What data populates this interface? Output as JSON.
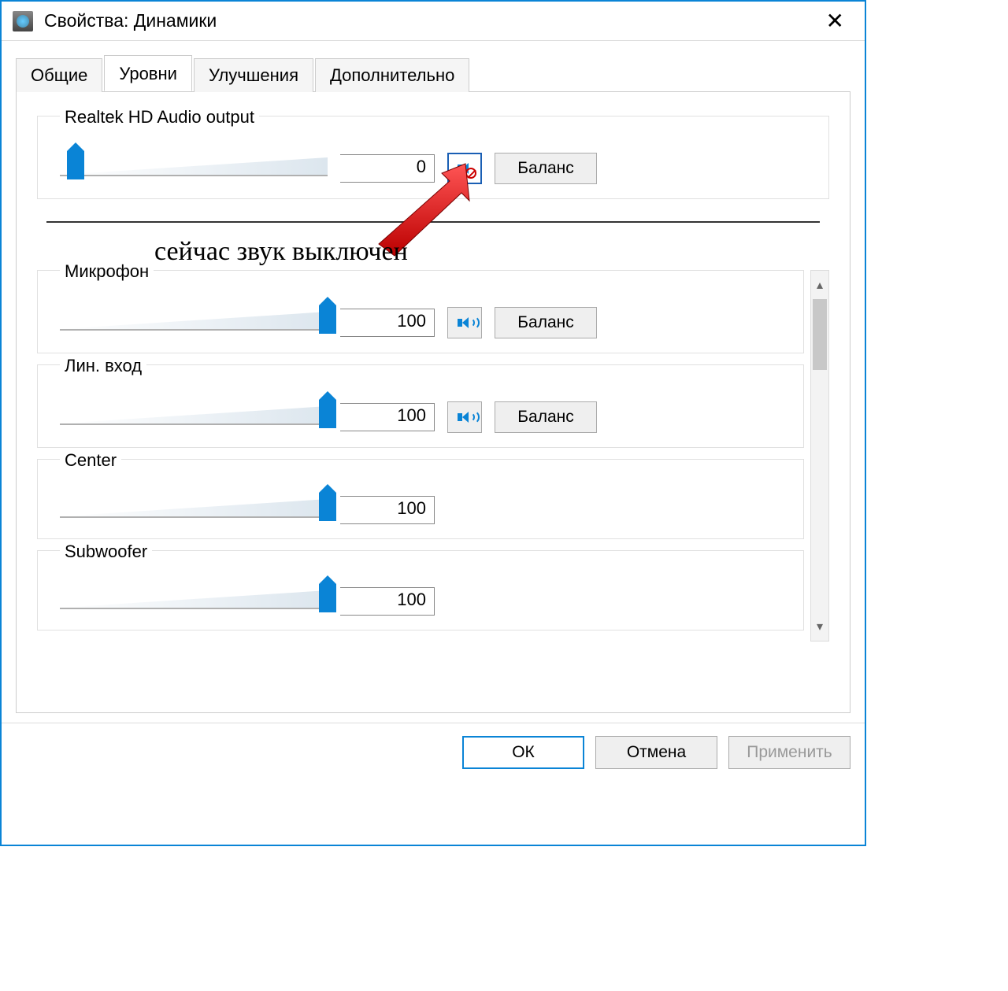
{
  "window": {
    "title": "Свойства: Динамики"
  },
  "tabs": [
    {
      "label": "Общие",
      "active": false
    },
    {
      "label": "Уровни",
      "active": true
    },
    {
      "label": "Улучшения",
      "active": false
    },
    {
      "label": "Дополнительно",
      "active": false
    }
  ],
  "main_device": {
    "name": "Realtek HD Audio output",
    "value": "0",
    "slider_percent": 6,
    "muted": true,
    "balance_label": "Баланс"
  },
  "annotation": {
    "text": "сейчас звук выключен"
  },
  "channels": [
    {
      "name": "Микрофон",
      "value": "100",
      "slider_percent": 100,
      "has_mute": true,
      "muted": false,
      "balance_label": "Баланс"
    },
    {
      "name": "Лин. вход",
      "value": "100",
      "slider_percent": 100,
      "has_mute": true,
      "muted": false,
      "balance_label": "Баланс"
    },
    {
      "name": "Center",
      "value": "100",
      "slider_percent": 100,
      "has_mute": false
    },
    {
      "name": "Subwoofer",
      "value": "100",
      "slider_percent": 100,
      "has_mute": false
    }
  ],
  "buttons": {
    "ok": "ОК",
    "cancel": "Отмена",
    "apply": "Применить"
  }
}
